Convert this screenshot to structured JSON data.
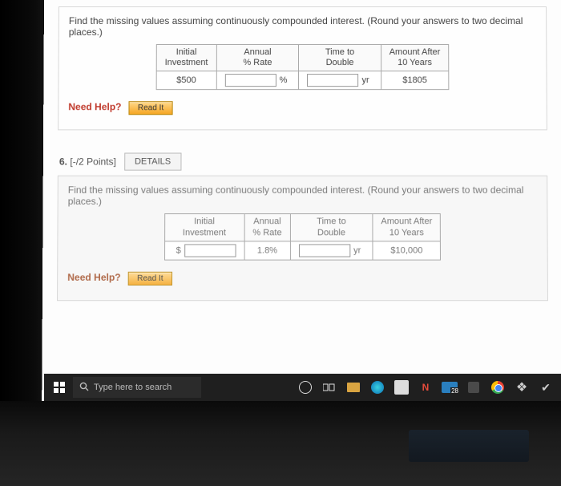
{
  "q1": {
    "prompt": "Find the missing values assuming continuously compounded interest. (Round your answers to two decimal places.)",
    "headers": {
      "c1a": "Initial",
      "c1b": "Investment",
      "c2a": "Annual",
      "c2b": "% Rate",
      "c3a": "Time to",
      "c3b": "Double",
      "c4a": "Amount After",
      "c4b": "10 Years"
    },
    "row": {
      "investment": "$500",
      "rate_unit": "%",
      "time_unit": "yr",
      "amount": "$1805"
    },
    "need_help": "Need Help?",
    "read_it": "Read It"
  },
  "q2": {
    "number": "6.",
    "points": "[-/2 Points]",
    "details": "DETAILS",
    "prompt": "Find the missing values assuming continuously compounded interest. (Round your answers to two decimal places.)",
    "headers": {
      "c1a": "Initial",
      "c1b": "Investment",
      "c2a": "Annual",
      "c2b": "% Rate",
      "c3a": "Time to",
      "c3b": "Double",
      "c4a": "Amount After",
      "c4b": "10 Years"
    },
    "row": {
      "currency": "$",
      "rate": "1.8%",
      "time_unit": "yr",
      "amount": "$10,000"
    },
    "need_help": "Need Help?",
    "read_it": "Read It"
  },
  "taskbar": {
    "search_placeholder": "Type here to search"
  }
}
